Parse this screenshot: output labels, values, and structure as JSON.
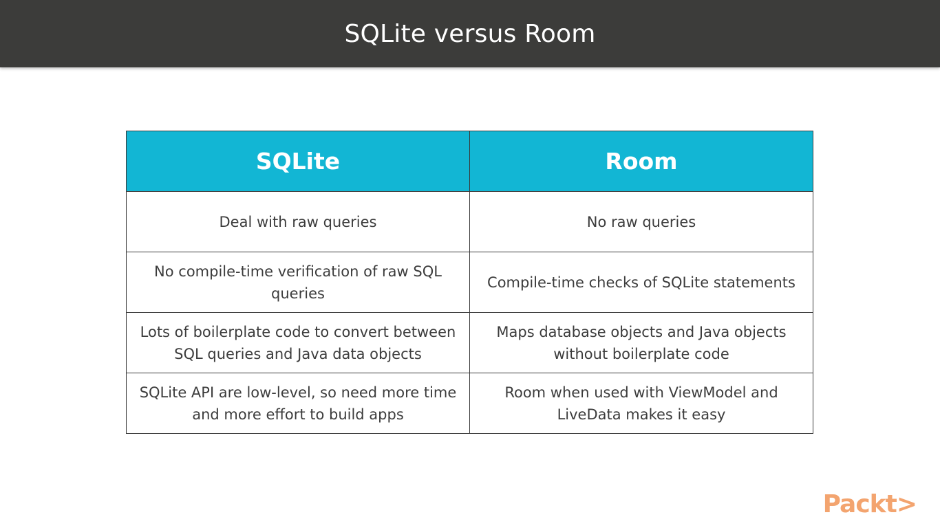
{
  "slide": {
    "title": "SQLite versus Room"
  },
  "table": {
    "headers": [
      "SQLite",
      "Room"
    ],
    "rows": [
      [
        "Deal with raw queries",
        "No raw queries"
      ],
      [
        "No compile-time verification of raw SQL queries",
        "Compile-time checks of SQLite statements"
      ],
      [
        "Lots of boilerplate code to convert between SQL queries and Java data objects",
        "Maps database objects and Java objects without boilerplate code"
      ],
      [
        "SQLite API are low-level, so need more time and more effort to build apps",
        "Room when used with ViewModel and LiveData makes it easy"
      ]
    ],
    "header_color": "#12b6d4"
  },
  "brand": {
    "logo_text": "Packt>",
    "logo_color": "#f3a46f"
  }
}
